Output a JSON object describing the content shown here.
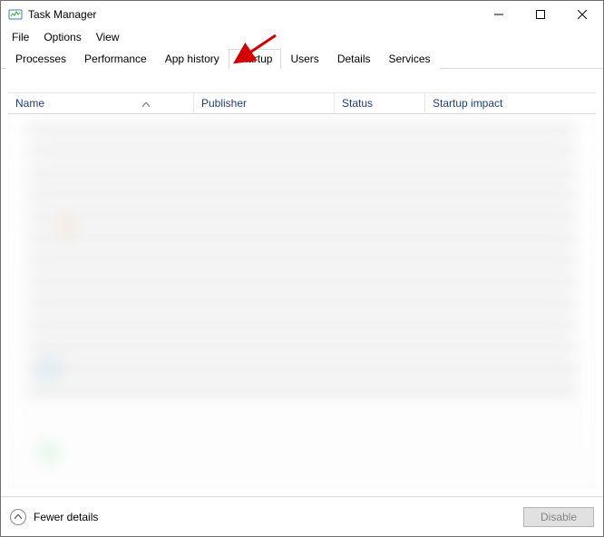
{
  "window": {
    "title": "Task Manager"
  },
  "menu": {
    "file": "File",
    "options": "Options",
    "view": "View"
  },
  "tabs": {
    "processes": "Processes",
    "performance": "Performance",
    "app_history": "App history",
    "startup": "Startup",
    "users": "Users",
    "details": "Details",
    "services": "Services",
    "active": "startup"
  },
  "columns": {
    "name": "Name",
    "publisher": "Publisher",
    "status": "Status",
    "impact": "Startup impact"
  },
  "footer": {
    "fewer_details": "Fewer details",
    "disable": "Disable"
  },
  "annotation": {
    "arrow_target": "startup-tab",
    "arrow_color": "#d40000"
  }
}
